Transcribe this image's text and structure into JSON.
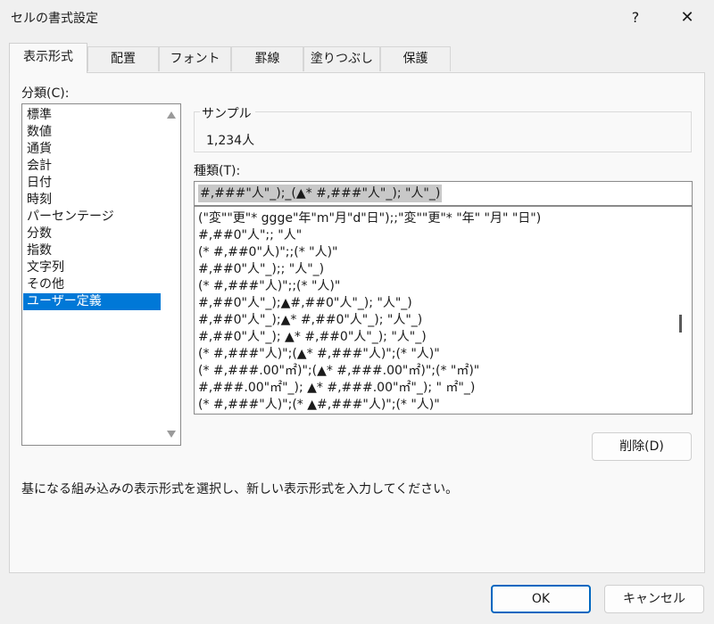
{
  "window": {
    "title": "セルの書式設定",
    "help_label": "?",
    "close_label": "✕"
  },
  "tabs": [
    {
      "label": "表示形式",
      "active": true
    },
    {
      "label": "配置",
      "active": false
    },
    {
      "label": "フォント",
      "active": false
    },
    {
      "label": "罫線",
      "active": false
    },
    {
      "label": "塗りつぶし",
      "active": false
    },
    {
      "label": "保護",
      "active": false
    }
  ],
  "category": {
    "label": "分類(C):",
    "items": [
      "標準",
      "数値",
      "通貨",
      "会計",
      "日付",
      "時刻",
      "パーセンテージ",
      "分数",
      "指数",
      "文字列",
      "その他",
      "ユーザー定義"
    ],
    "selected_index": 11
  },
  "sample": {
    "title": "サンプル",
    "value": "1,234人"
  },
  "type": {
    "label": "種類(T):",
    "value": "#,###\"人\"_);_(▲* #,###\"人\"_); \"人\"_)"
  },
  "format_list": [
    "(\"変\"\"更\"* ggge\"年\"m\"月\"d\"日\");;\"変\"\"更\"*  \"年\"    \"月\"    \"日\")",
    "#,##0\"人\";;    \"人\"",
    "(* #,##0\"人)\";;(*     \"人)\"",
    "#,##0\"人\"_);;    \"人\"_)",
    "(* #,###\"人)\";;(*     \"人)\"",
    "#,##0\"人\"_);▲#,##0\"人\"_);    \"人\"_)",
    "#,##0\"人\"_);▲* #,##0\"人\"_);    \"人\"_)",
    "#,##0\"人\"_); ▲* #,##0\"人\"_);    \"人\"_)",
    "(* #,###\"人)\";(▲* #,###\"人)\";(*     \"人)\"",
    "(* #,###.00\"㎡)\";(▲* #,###.00\"㎡)\";(*     \"㎡)\"",
    "#,###.00\"㎡\"_); ▲* #,###.00\"㎡\"_);    \" ㎡\"_)",
    "(* #,###\"人)\";(* ▲#,###\"人)\";(*     \"人)\""
  ],
  "delete_label": "削除(D)",
  "description": "基になる組み込みの表示形式を選択し、新しい表示形式を入力してください。",
  "buttons": {
    "ok": "OK",
    "cancel": "キャンセル"
  },
  "colors": {
    "selection": "#0078d7",
    "ok_border": "#0067c0"
  }
}
